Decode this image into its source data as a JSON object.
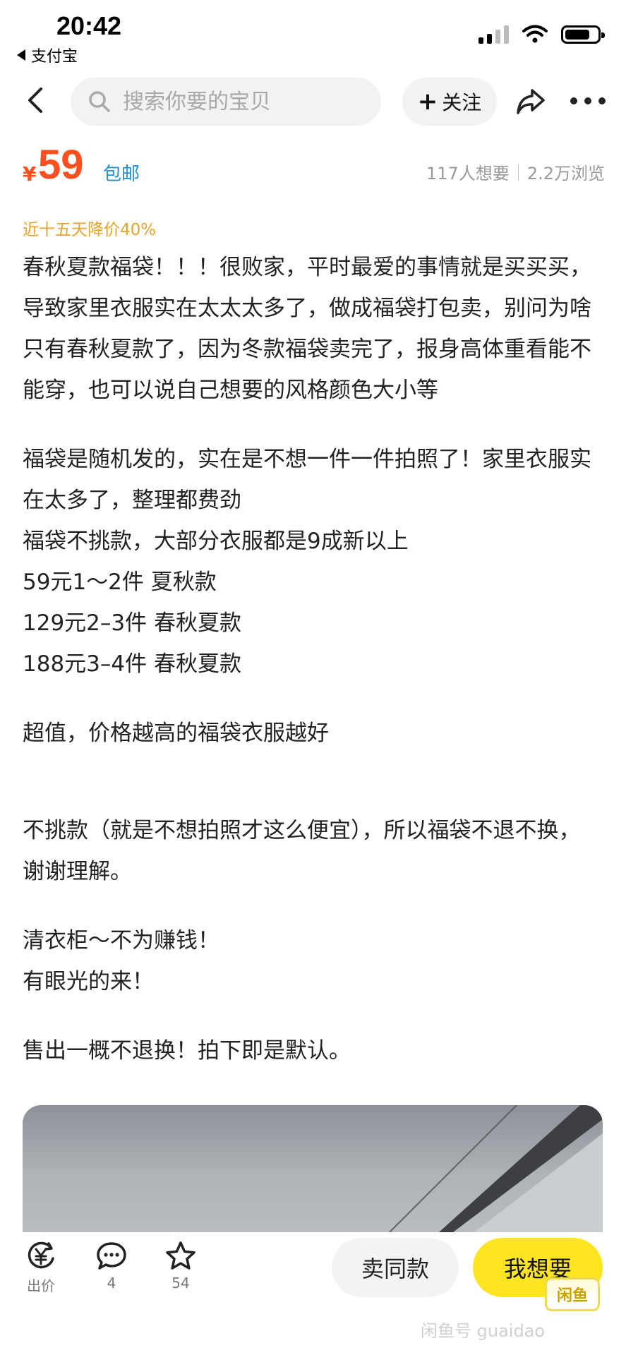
{
  "status_bar": {
    "time": "20:42",
    "back_app": "支付宝"
  },
  "nav": {
    "search_placeholder": "搜索你要的宝贝",
    "follow_label": "关注"
  },
  "listing": {
    "currency": "¥",
    "price": "59",
    "shipping": "包邮",
    "wants": "117人想要",
    "views": "2.2万浏览",
    "price_drop": "近十五天降价40%"
  },
  "description": {
    "p1": "春秋夏款福袋！！！很败家，平时最爱的事情就是买买买，导致家里衣服实在太太太多了，做成福袋打包卖，别问为啥只有春秋夏款了，因为冬款福袋卖完了，报身高体重看能不能穿，也可以说自己想要的风格颜色大小等",
    "p2": "福袋是随机发的，实在是不想一件一件拍照了！家里衣服实在太多了，整理都费劲",
    "p3": "福袋不挑款，大部分衣服都是9成新以上",
    "p4": "59元1～2件 夏秋款",
    "p5": "129元2–3件 春秋夏款",
    "p6": "188元3–4件 春秋夏款",
    "p7": "超值，价格越高的福袋衣服越好",
    "p8": "不挑款（就是不想拍照才这么便宜），所以福袋不退不换，谢谢理解。",
    "p9": "清衣柜～不为赚钱！",
    "p10": "有眼光的来！",
    "p11": "售出一概不退换！拍下即是默认。"
  },
  "bottom_bar": {
    "offer_label": "出价",
    "comments_count": "4",
    "favorites_count": "54",
    "same_button": "卖同款",
    "want_button": "我想要",
    "logo_text": "闲鱼"
  },
  "watermark": "闲鱼号 guaidao"
}
